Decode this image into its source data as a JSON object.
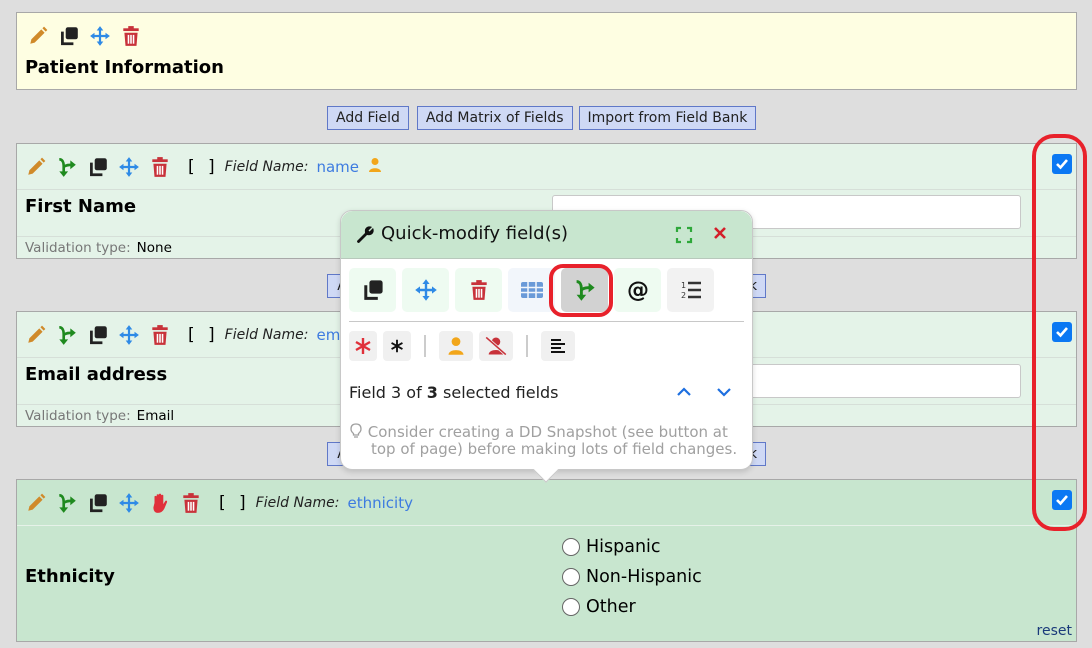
{
  "section": {
    "title": "Patient Information",
    "icons": [
      "pencil-icon",
      "copy-icon",
      "move-icon",
      "trash-icon"
    ]
  },
  "add_buttons": {
    "add_field": "Add Field",
    "add_matrix": "Add Matrix of Fields",
    "import_bank": "Import from Field Bank",
    "partial_left": "A",
    "partial_right": "k"
  },
  "fields": [
    {
      "brackets": "[ ]",
      "field_name_label": "Field Name:",
      "field_name": "name",
      "label": "First Name",
      "identifier_icon": "person-icon",
      "validation_label": "Validation type:",
      "validation_value": "None",
      "checked": true,
      "type": "text"
    },
    {
      "brackets": "[ ]",
      "field_name_label": "Field Name:",
      "field_name": "email",
      "label": "Email address",
      "validation_label": "Validation type:",
      "validation_value": "Email",
      "checked": true,
      "type": "text"
    },
    {
      "brackets": "[ ]",
      "field_name_label": "Field Name:",
      "field_name": "ethnicity",
      "label": "Ethnicity",
      "checked": true,
      "type": "radio",
      "options": [
        "Hispanic",
        "Non-Hispanic",
        "Other"
      ],
      "reset_label": "reset"
    }
  ],
  "quick_modify": {
    "title": "Quick-modify field(s)",
    "toolbar_row1": [
      "copy-icon",
      "move-icon",
      "trash-icon",
      "matrix-icon",
      "branching-icon",
      "at-sign-icon",
      "numbered-list-icon"
    ],
    "active_tool": "branching-icon",
    "toolbar_row2": [
      "required-on-icon",
      "required-off-icon",
      "identifier-on-icon",
      "identifier-off-icon",
      "align-icon"
    ],
    "count_prefix": "Field 3 of ",
    "count_total": "3",
    "count_suffix": " selected fields",
    "tip_line1": "Consider creating a DD Snapshot (see button at",
    "tip_line2": "top of page) before making lots of field changes."
  },
  "colors": {
    "selected_bg": "#c8e6cf",
    "field_bg": "#e4f3e8",
    "highlight_red": "#e8212b",
    "checkbox_blue": "#0b78f3"
  }
}
